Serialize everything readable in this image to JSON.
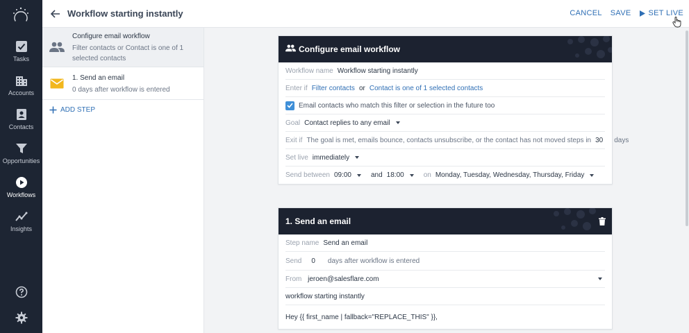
{
  "nav": {
    "items": [
      {
        "label": "Tasks",
        "icon": "tasks-icon"
      },
      {
        "label": "Accounts",
        "icon": "accounts-icon"
      },
      {
        "label": "Contacts",
        "icon": "contacts-icon"
      },
      {
        "label": "Opportunities",
        "icon": "opportunities-icon"
      },
      {
        "label": "Workflows",
        "icon": "workflows-icon",
        "active": true
      },
      {
        "label": "Insights",
        "icon": "insights-icon"
      }
    ],
    "bottom": [
      {
        "icon": "help-icon"
      },
      {
        "icon": "settings-icon"
      }
    ]
  },
  "header": {
    "title": "Workflow starting instantly",
    "cancel": "CANCEL",
    "save": "SAVE",
    "set_live": "SET LIVE"
  },
  "steps": {
    "items": [
      {
        "title": "Configure email workflow",
        "subtitle": "Filter contacts or Contact is one of 1 selected contacts",
        "icon": "people-icon"
      },
      {
        "title": "1. Send an email",
        "subtitle": "0 days after workflow is entered",
        "icon": "envelope-icon"
      }
    ],
    "add_step": "ADD STEP"
  },
  "config_card": {
    "title": "Configure email workflow",
    "workflow_name_label": "Workflow name",
    "workflow_name_value": "Workflow starting instantly",
    "enter_if_label": "Enter if",
    "enter_if_link1": "Filter contacts",
    "enter_if_or": "or",
    "enter_if_link2": "Contact is one of 1 selected contacts",
    "checkbox_label": "Email contacts who match this filter or selection in the future too",
    "checkbox_checked": true,
    "goal_label": "Goal",
    "goal_value": "Contact replies to any email",
    "exit_if_label": "Exit if",
    "exit_if_text": "The goal is met, emails bounce, contacts unsubscribe, or the contact has not moved steps in",
    "exit_if_days": "30",
    "exit_if_unit": "days",
    "set_live_label": "Set live",
    "set_live_value": "immediately",
    "send_between_label": "Send between",
    "send_from": "09:00",
    "send_and": "and",
    "send_to": "18:00",
    "send_on": "on",
    "send_days": "Monday, Tuesday, Wednesday, Thursday, Friday"
  },
  "email_card": {
    "title": "1. Send an email",
    "step_name_label": "Step name",
    "step_name_value": "Send an email",
    "send_label": "Send",
    "send_days": "0",
    "send_suffix": "days after workflow is entered",
    "from_label": "From",
    "from_value": "jeroen@salesflare.com",
    "subject": "workflow starting instantly",
    "body_line1": "Hey {{ first_name | fallback=\"REPLACE_THIS\" }},"
  },
  "colors": {
    "nav_bg": "#1d2533",
    "card_header_bg": "#1c2230",
    "accent": "#2f6fb5",
    "checkbox": "#3f8fd8",
    "envelope": "#f2b71d"
  }
}
